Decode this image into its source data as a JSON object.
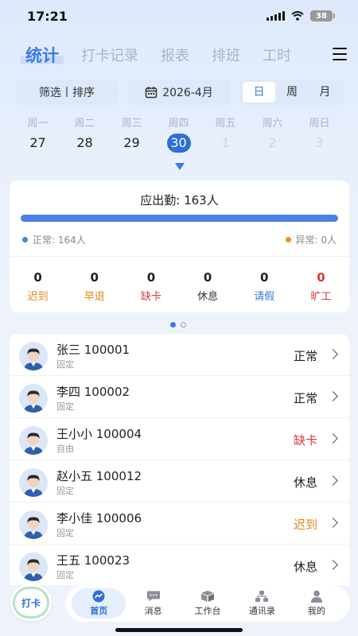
{
  "status_bar": {
    "time": "17:21",
    "battery": "38"
  },
  "tabs": [
    {
      "label": "统计",
      "active": true
    },
    {
      "label": "打卡记录",
      "active": false
    },
    {
      "label": "报表",
      "active": false
    },
    {
      "label": "排班",
      "active": false
    },
    {
      "label": "工时",
      "active": false
    }
  ],
  "filters": {
    "sort_label": "筛选丨排序",
    "date_label": "2026-4月",
    "segments": [
      "日",
      "周",
      "月"
    ],
    "selected_segment": "日"
  },
  "week": [
    {
      "weekday": "周一",
      "date": "27"
    },
    {
      "weekday": "周二",
      "date": "28"
    },
    {
      "weekday": "周三",
      "date": "29"
    },
    {
      "weekday": "周四",
      "date": "30"
    },
    {
      "weekday": "周五",
      "date": "1"
    },
    {
      "weekday": "周六",
      "date": "2"
    },
    {
      "weekday": "周日",
      "date": "3"
    }
  ],
  "summary": {
    "title": "应出勤: 163人",
    "normal_label": "正常: 164人",
    "abnormal_label": "异常: 0人",
    "normal_fraction": 1.0,
    "stats": [
      {
        "value": "0",
        "label": "迟到",
        "color": "#e08a1e"
      },
      {
        "value": "0",
        "label": "早退",
        "color": "#e08a1e"
      },
      {
        "value": "0",
        "label": "缺卡",
        "color": "#d93a3a"
      },
      {
        "value": "0",
        "label": "休息",
        "color": "#333333"
      },
      {
        "value": "0",
        "label": "请假",
        "color": "#3d7ae6"
      },
      {
        "value": "0",
        "label": "旷工",
        "color": "#d93a3a"
      }
    ]
  },
  "employees": [
    {
      "name": "张三 100001",
      "type": "固定",
      "status": "正常",
      "status_color": "#222222"
    },
    {
      "name": "李四 100002",
      "type": "固定",
      "status": "正常",
      "status_color": "#222222"
    },
    {
      "name": "王小小 100004",
      "type": "自由",
      "status": "缺卡",
      "status_color": "#d93a3a"
    },
    {
      "name": "赵小五 100012",
      "type": "固定",
      "status": "休息",
      "status_color": "#222222"
    },
    {
      "name": "李小佳 100006",
      "type": "固定",
      "status": "迟到",
      "status_color": "#e08a1e"
    },
    {
      "name": "王五 100023",
      "type": "固定",
      "status": "休息",
      "status_color": "#222222"
    }
  ],
  "bottom_nav": {
    "punch_label": "打卡",
    "items": [
      {
        "label": "首页",
        "icon": "home-icon",
        "active": true
      },
      {
        "label": "消息",
        "icon": "message-icon",
        "active": false
      },
      {
        "label": "工作台",
        "icon": "workbench-icon",
        "active": false
      },
      {
        "label": "通讯录",
        "icon": "contacts-icon",
        "active": false
      },
      {
        "label": "我的",
        "icon": "profile-icon",
        "active": false
      }
    ]
  },
  "colors": {
    "accent": "#3d7ae6",
    "selected_date": "#2f6fd8",
    "normal_dot": "#4b80e6",
    "abnormal_dot": "#e8951f"
  }
}
